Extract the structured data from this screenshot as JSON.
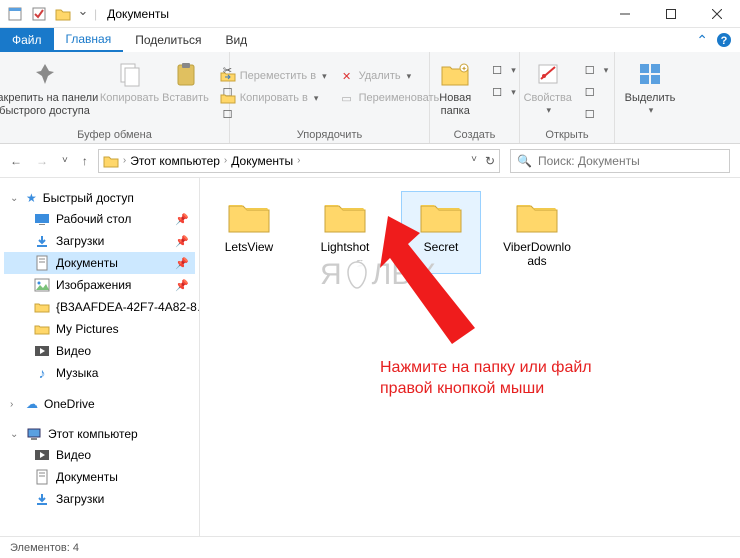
{
  "window": {
    "title": "Документы"
  },
  "tabs": {
    "file": "Файл",
    "home": "Главная",
    "share": "Поделиться",
    "view": "Вид"
  },
  "ribbon": {
    "clipboard": {
      "pin": "Закрепить на панели быстрого доступа",
      "copy": "Копировать",
      "paste": "Вставить",
      "group": "Буфер обмена"
    },
    "organize": {
      "move": "Переместить в",
      "copyto": "Копировать в",
      "delete": "Удалить",
      "rename": "Переименовать",
      "group": "Упорядочить"
    },
    "new": {
      "newfolder": "Новая папка",
      "group": "Создать"
    },
    "open": {
      "properties": "Свойства",
      "group": "Открыть"
    },
    "select": {
      "select": "Выделить",
      "group": ""
    }
  },
  "breadcrumb": {
    "pc": "Этот компьютер",
    "docs": "Документы"
  },
  "search": {
    "placeholder": "Поиск: Документы"
  },
  "sidebar": {
    "quick": "Быстрый доступ",
    "items": [
      {
        "label": "Рабочий стол",
        "pinned": true
      },
      {
        "label": "Загрузки",
        "pinned": true
      },
      {
        "label": "Документы",
        "pinned": true,
        "selected": true
      },
      {
        "label": "Изображения",
        "pinned": true
      },
      {
        "label": "{B3AAFDEA-42F7-4A82-8…",
        "pinned": false
      },
      {
        "label": "My Pictures",
        "pinned": false
      },
      {
        "label": "Видео",
        "pinned": false
      },
      {
        "label": "Музыка",
        "pinned": false
      }
    ],
    "onedrive": "OneDrive",
    "thispc": "Этот компьютер",
    "pcitems": [
      {
        "label": "Видео"
      },
      {
        "label": "Документы"
      },
      {
        "label": "Загрузки"
      }
    ]
  },
  "folders": [
    {
      "name": "LetsView"
    },
    {
      "name": "Lightshot"
    },
    {
      "name": "Secret",
      "selected": true
    },
    {
      "name": "ViberDownloads"
    }
  ],
  "watermark": "ЯБЛЫК",
  "annotation": {
    "line1": "Нажмите на папку или файл",
    "line2": "правой кнопкой мыши"
  },
  "statusbar": {
    "elements": "Элементов: 4"
  }
}
